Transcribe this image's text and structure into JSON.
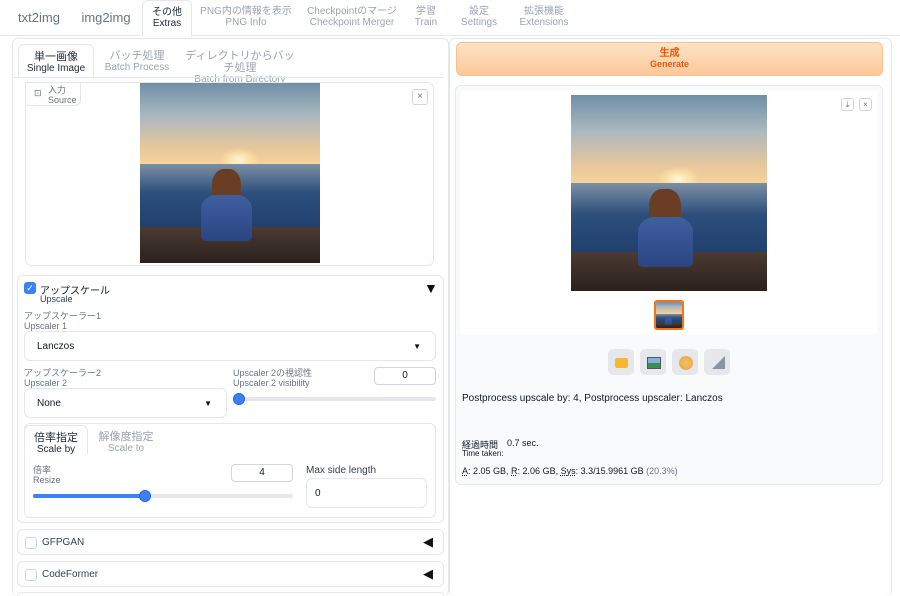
{
  "nav": {
    "tabs": [
      {
        "label": "txt2img"
      },
      {
        "label": "img2img"
      },
      {
        "jp": "その他",
        "en": "Extras"
      },
      {
        "jp": "PNG内の情報を表示",
        "en": "PNG Info"
      },
      {
        "jp": "Checkpointのマージ",
        "en": "Checkpoint Merger"
      },
      {
        "jp": "学習",
        "en": "Train"
      },
      {
        "jp": "設定",
        "en": "Settings"
      },
      {
        "jp": "拡張機能",
        "en": "Extensions"
      }
    ],
    "active": "Extras"
  },
  "left": {
    "subtabs": [
      {
        "jp": "単一画像",
        "en": "Single Image"
      },
      {
        "jp": "バッチ処理",
        "en": "Batch Process"
      },
      {
        "jp": "ディレクトリからバッチ処理",
        "en": "Batch from Directory"
      }
    ],
    "source": {
      "jp": "入力",
      "en": "Source",
      "close": "×"
    },
    "upscale": {
      "jp": "アップスケール",
      "en": "Upscale",
      "checked": true,
      "upscaler1": {
        "jp": "アップスケーラー1",
        "en": "Upscaler 1",
        "value": "Lanczos"
      },
      "upscaler2": {
        "jp": "アップスケーラー2",
        "en": "Upscaler 2",
        "value": "None"
      },
      "visibility": {
        "jp": "Upscaler 2の視認性",
        "en": "Upscaler 2 visibility",
        "value": "0",
        "level": 0
      },
      "scale_tabs": [
        {
          "jp": "倍率指定",
          "en": "Scale by"
        },
        {
          "jp": "解像度指定",
          "en": "Scale to"
        }
      ],
      "resize": {
        "jp": "倍率",
        "en": "Resize",
        "value": "4",
        "level": 0.43
      },
      "max_side": {
        "label": "Max side length",
        "value": "0"
      }
    },
    "accordions": [
      {
        "label": "GFPGAN",
        "checked": false
      },
      {
        "label": "CodeFormer",
        "checked": false
      }
    ]
  },
  "right": {
    "generate": {
      "jp": "生成",
      "en": "Generate"
    },
    "gallery_buttons": {
      "download": "⤓",
      "close": "×"
    },
    "actions": [
      "folder-icon",
      "image-icon",
      "palette-icon",
      "ruler-icon"
    ],
    "info": "Postprocess upscale by: 4, Postprocess upscaler: Lanczos",
    "time": {
      "jp": "経過時間",
      "value": "0.7 sec.",
      "en": "Time taken:"
    },
    "memory": {
      "a_label": "A",
      "a_value": ": 2.05 GB, ",
      "r_label": "R",
      "r_value": ": 2.06 GB, ",
      "sys_label": "Sys",
      "sys_value": ": 3.3/15.9961 GB",
      "pct": " (20.3%)"
    }
  }
}
